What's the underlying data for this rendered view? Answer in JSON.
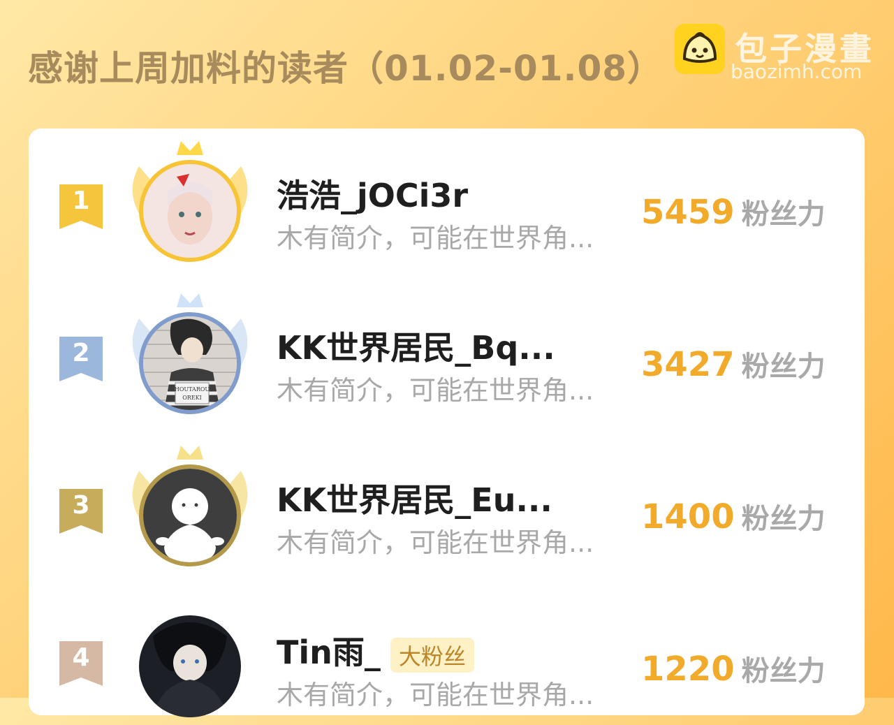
{
  "header": {
    "title": "感谢上周加料的读者（01.02-01.08）"
  },
  "watermark": {
    "name": "包子漫畫",
    "url": "baozimh.com",
    "logo_icon": "bun-face-icon"
  },
  "colors": {
    "score": "#f2aa2b",
    "gold": "#f5c53c",
    "silver": "#9bb7dc",
    "bronze": "#c6ac5b",
    "rank4": "#d6b9a4"
  },
  "leaderboard": [
    {
      "rank": "1",
      "tier": "gold",
      "username": "浩浩_jOCi3r",
      "bio": "木有简介，可能在世界角...",
      "score": "5459",
      "score_unit": "粉丝力",
      "tag": ""
    },
    {
      "rank": "2",
      "tier": "silver",
      "username": "KK世界居民_Bq...",
      "bio": "木有简介，可能在世界角...",
      "score": "3427",
      "score_unit": "粉丝力",
      "tag": "",
      "avatar_sign": [
        "HOUTAROU",
        "OREKI"
      ]
    },
    {
      "rank": "3",
      "tier": "bronze",
      "username": "KK世界居民_Eu...",
      "bio": "木有简介，可能在世界角...",
      "score": "1400",
      "score_unit": "粉丝力",
      "tag": ""
    },
    {
      "rank": "4",
      "tier": "plain",
      "username": "Tin雨_",
      "bio": "木有简介，可能在世界角...",
      "score": "1220",
      "score_unit": "粉丝力",
      "tag": "大粉丝"
    }
  ]
}
